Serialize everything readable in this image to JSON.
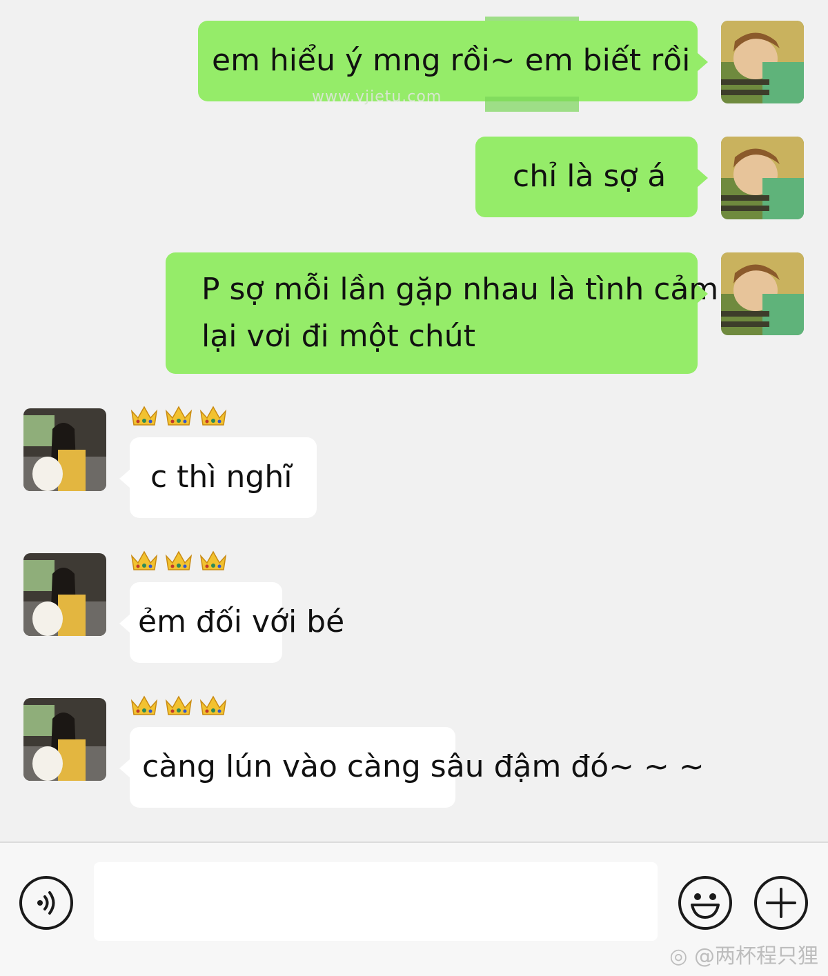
{
  "messages": [
    {
      "direction": "outgoing",
      "text": "em hiểu ý mng rồi~  em biết rồi"
    },
    {
      "direction": "outgoing",
      "text": "chỉ là sợ á"
    },
    {
      "direction": "outgoing",
      "text_line1": "P sợ mỗi lần gặp nhau là tình cảm",
      "text_line2": "lại vơi đi một chút"
    },
    {
      "direction": "incoming",
      "badge": "crowns",
      "text": "c thì nghĩ"
    },
    {
      "direction": "incoming",
      "badge": "crowns",
      "text": "ẻm đối với bé"
    },
    {
      "direction": "incoming",
      "badge": "crowns",
      "text": "càng lún vào càng sâu đậm đó~ ~ ~"
    }
  ],
  "watermark": "www.vjietu.com",
  "input_bar": {
    "voice_icon": "voice-icon",
    "emoji_icon": "emoji-icon",
    "plus_icon": "plus-icon",
    "input_value": ""
  },
  "credit": "@两杯程只狸",
  "colors": {
    "outgoing_bubble": "#95ec69",
    "incoming_bubble": "#ffffff",
    "background": "#f1f1f1"
  }
}
